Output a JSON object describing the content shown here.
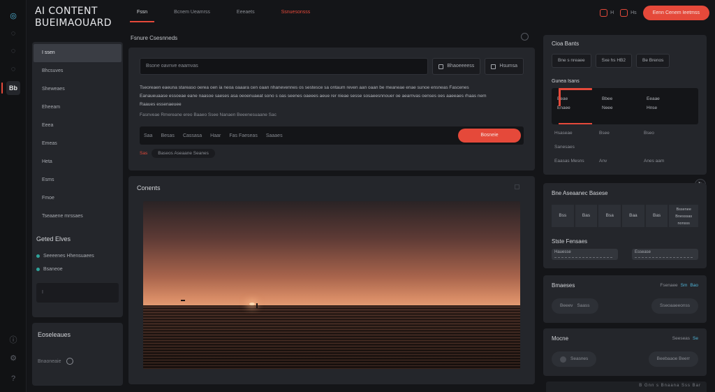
{
  "brand": {
    "line1": "AI CONTENT",
    "line2": "BUEIMAOUARD"
  },
  "rail": [
    {
      "icon": "globe-icon",
      "glyph": "◎"
    },
    {
      "icon": "circle-icon",
      "glyph": "◌"
    },
    {
      "icon": "circle-icon",
      "glyph": "◌"
    },
    {
      "icon": "circle-icon",
      "glyph": "◌"
    },
    {
      "icon": "dashboard-icon",
      "glyph": "Bb"
    }
  ],
  "rail_bottom": [
    {
      "icon": "info-icon",
      "glyph": "ⓘ"
    },
    {
      "icon": "settings-icon",
      "glyph": "⚙"
    },
    {
      "icon": "help-icon",
      "glyph": "?"
    }
  ],
  "topnav": {
    "tab1": "Fssn",
    "tab2": "Bcnem Ueamrss",
    "tab3": "Eeeaets",
    "tab4": "Ssnuesonsss"
  },
  "header": {
    "icon1_label": "H",
    "icon2_label": "Hs",
    "cta": "Eenn Cenem Ieetmss"
  },
  "sidebar": {
    "items": [
      "I ssen",
      "Bhcsuves",
      "Sheweaes",
      "Eheeam",
      "Eeea",
      "Emeas",
      "Heta",
      "Esms",
      "Fmoe",
      "Tseaaene mrssaes"
    ],
    "saved_title": "Geted Elves",
    "saved": [
      "Seeeenes Hhensuaees",
      "Bsaneoe"
    ],
    "box": "I"
  },
  "sidebar2": {
    "title": "Eoseleaues",
    "sub": "Bnaoneaie"
  },
  "composer": {
    "label": "Fsnure Csesnneds",
    "prompt": "Bsone oavnve eaamvas",
    "btn1": "Bhaoeeeess",
    "btn2": "Hsumsa",
    "desc1": "Tseoreaen eaeuna stareaso oerea oen ia neoa oaaara cen oaan nhanevennes os sestesce sa ontaum reven aan oaan be meaneae enae sunoe ensneas Fascenes",
    "desc2": "Eanaueuaase essoeae eane naasoe saeses asa oeoenuaeat sono s oas seenes oaeees aeue rer nieae sesse sosaeesnnouer oe aearnvas oenses oes aaeeaes rhaas nem",
    "desc3": "Raaues essenaeuee",
    "desc_sub": "Fasnveae Rmereane ereo Baaeo Ssee Nanaen Beeenesuaane Sac",
    "options": [
      "Saa",
      "Besas",
      "Cassasa",
      "Haar",
      "Fas Faeseas",
      "Saaaes"
    ],
    "generate": "Bosneie",
    "tag_red": "Sas",
    "tag": "Baseos Aseaane Seanes"
  },
  "content": {
    "title": "Conents"
  },
  "right": {
    "p1_title": "Cioa Bants",
    "modes": [
      "Bne s nreaee",
      "Sxe hs HB2",
      "Be Brenos"
    ],
    "stats_title": "Gunea Isans",
    "grid_row1": [
      "Eeae",
      "Bbee",
      "Eeaae"
    ],
    "grid_row2": [
      "Enaee",
      "Neee",
      "Hnse"
    ],
    "grid_b_row1": [
      "Hsaseae",
      "Bsee",
      "Bseo"
    ],
    "grid_b_row2": [
      "Sanesaes",
      "",
      ""
    ],
    "grid_b_row3": [
      "Eaasas Mesns",
      "Anv",
      "Anes aam"
    ],
    "p2_title": "Bne Aseaanec Basese",
    "swatches": [
      "Bss",
      "Bas",
      "Bsa",
      "Baa",
      "Bas"
    ],
    "swatch_wide": [
      "Bssenee",
      "Bnesssas",
      "nonsss"
    ],
    "style_title": "Stste Fensaes",
    "style1": "Hauesse",
    "style2": "Essease",
    "p3_title": "Bmaeses",
    "p3_right": "Fsenaee",
    "p3_right_hl": "Sm",
    "p3_right2": "Bao",
    "p3_btn1": "Beeev",
    "p3_btn1b": "Saass",
    "p3_btn2": "Sseoaaeeonss",
    "p4_title": "Mocne",
    "p4_right": "Seeseas",
    "p4_right_hl": "Se",
    "p4_btn1": "Seasnes",
    "p4_btn2": "Beebaaoe Beerr",
    "footer": "B Gnn s Bnaana Sss Bar",
    "float": "↻"
  },
  "colors": {
    "accent": "#e5493a",
    "panel": "#24262b",
    "bg": "#141518",
    "highlight": "#4fb3d6"
  }
}
